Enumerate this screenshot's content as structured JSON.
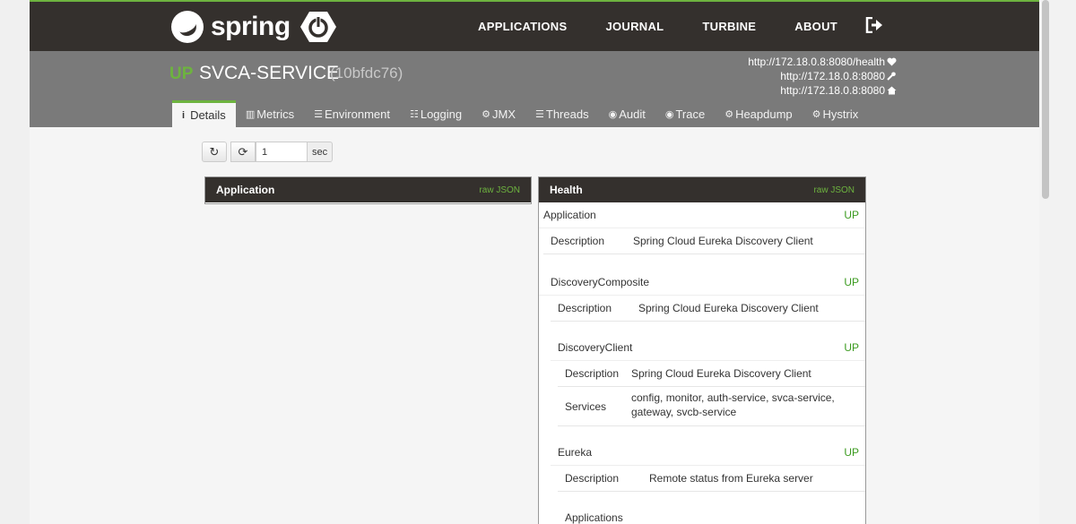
{
  "nav": {
    "brand": "spring",
    "links": [
      "APPLICATIONS",
      "JOURNAL",
      "TURBINE",
      "ABOUT"
    ]
  },
  "header": {
    "status": "UP",
    "service_name": "SVCA-SERVICE",
    "service_id": "(10bfdc76)",
    "urls": [
      {
        "text": "http://172.18.0.8:8080/health",
        "icon": "heart-icon"
      },
      {
        "text": "http://172.18.0.8:8080",
        "icon": "wrench-icon"
      },
      {
        "text": "http://172.18.0.8:8080",
        "icon": "home-icon"
      }
    ]
  },
  "tabs": [
    {
      "label": "Details",
      "icon": "i"
    },
    {
      "label": "Metrics",
      "icon": "▥"
    },
    {
      "label": "Environment",
      "icon": "☰"
    },
    {
      "label": "Logging",
      "icon": "☷"
    },
    {
      "label": "JMX",
      "icon": "⚙"
    },
    {
      "label": "Threads",
      "icon": "☰"
    },
    {
      "label": "Audit",
      "icon": "◉"
    },
    {
      "label": "Trace",
      "icon": "◉"
    },
    {
      "label": "Heapdump",
      "icon": "⚙"
    },
    {
      "label": "Hystrix",
      "icon": "⚙"
    }
  ],
  "controls": {
    "refresh_icon": "↻",
    "auto_refresh_icon": "⟳",
    "interval_value": "1",
    "interval_unit": "sec"
  },
  "application_panel": {
    "title": "Application",
    "raw_json": "raw JSON"
  },
  "health_panel": {
    "title": "Health",
    "raw_json": "raw JSON",
    "application": {
      "label": "Application",
      "status": "UP",
      "desc_key": "Description",
      "desc_val": "Spring Cloud Eureka Discovery Client"
    },
    "discovery_composite": {
      "label": "DiscoveryComposite",
      "status": "UP",
      "desc_key": "Description",
      "desc_val": "Spring Cloud Eureka Discovery Client"
    },
    "discovery_client": {
      "label": "DiscoveryClient",
      "status": "UP",
      "desc_key": "Description",
      "desc_val": "Spring Cloud Eureka Discovery Client",
      "services_key": "Services",
      "services_line1": "config, monitor, auth-service, svca-service,",
      "services_line2": "gateway, svcb-service"
    },
    "eureka": {
      "label": "Eureka",
      "status": "UP",
      "desc_key": "Description",
      "desc_val": "Remote status from Eureka server",
      "next_label": "Applications"
    }
  }
}
